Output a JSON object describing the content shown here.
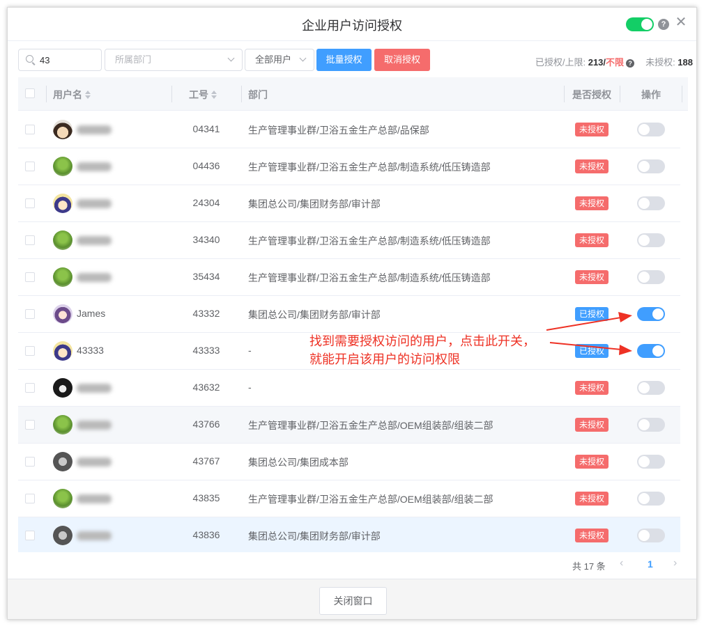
{
  "dialog": {
    "title": "企业用户访问授权",
    "help_glyph": "?",
    "close_glyph": "✕"
  },
  "toolbar": {
    "search_value": "43",
    "dept_placeholder": "所属部门",
    "user_filter": "全部用户",
    "batch_button": "批量授权",
    "cancel_button": "取消授权",
    "stats_authorized_label": "已授权/上限: ",
    "stats_authorized": "213",
    "stats_slash": "/",
    "stats_limit": "不限",
    "stats_help": "?",
    "stats_unauthorized_label": "未授权: ",
    "stats_unauthorized": "188"
  },
  "table": {
    "columns": {
      "username": "用户名",
      "id": "工号",
      "dept": "部门",
      "authorized": "是否授权",
      "action": "操作"
    },
    "rows": [
      {
        "name": "",
        "id": "04341",
        "dept": "生产管理事业群/卫浴五金生产总部/品保部",
        "status": "未授权",
        "on": false
      },
      {
        "name": "",
        "id": "04436",
        "dept": "生产管理事业群/卫浴五金生产总部/制造系统/低压铸造部",
        "status": "未授权",
        "on": false
      },
      {
        "name": "",
        "id": "24304",
        "dept": "集团总公司/集团财务部/审计部",
        "status": "未授权",
        "on": false
      },
      {
        "name": "",
        "id": "34340",
        "dept": "生产管理事业群/卫浴五金生产总部/制造系统/低压铸造部",
        "status": "未授权",
        "on": false
      },
      {
        "name": "",
        "id": "35434",
        "dept": "生产管理事业群/卫浴五金生产总部/制造系统/低压铸造部",
        "status": "未授权",
        "on": false
      },
      {
        "name": "James",
        "id": "43332",
        "dept": "集团总公司/集团财务部/审计部",
        "status": "已授权",
        "on": true
      },
      {
        "name": "43333",
        "id": "43333",
        "dept": "-",
        "status": "已授权",
        "on": true
      },
      {
        "name": "",
        "id": "43632",
        "dept": "-",
        "status": "未授权",
        "on": false
      },
      {
        "name": "",
        "id": "43766",
        "dept": "生产管理事业群/卫浴五金生产总部/OEM组装部/组装二部",
        "status": "未授权",
        "on": false
      },
      {
        "name": "",
        "id": "43767",
        "dept": "集团总公司/集团成本部",
        "status": "未授权",
        "on": false
      },
      {
        "name": "",
        "id": "43835",
        "dept": "生产管理事业群/卫浴五金生产总部/OEM组装部/组装二部",
        "status": "未授权",
        "on": false
      },
      {
        "name": "",
        "id": "43836",
        "dept": "集团总公司/集团财务部/审计部",
        "status": "未授权",
        "on": false
      }
    ]
  },
  "annotation": {
    "line1": "找到需要授权访问的用户，点击此开关，",
    "line2": "就能开启该用户的访问权限"
  },
  "pager": {
    "total": "共 17 条",
    "prev": "‹",
    "page": "1",
    "next": "›"
  },
  "footer": {
    "close_button": "关闭窗口"
  },
  "colors": {
    "primary": "#409eff",
    "danger": "#f56c6c",
    "success": "#13ce66",
    "annotation": "#ee3124"
  }
}
